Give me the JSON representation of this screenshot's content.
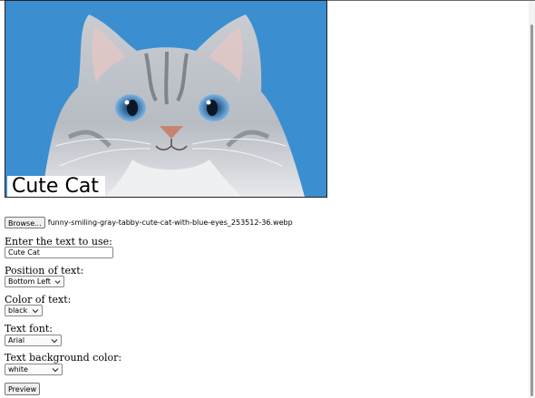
{
  "canvas": {
    "caption_text": "Cute Cat",
    "caption_color": "#000000",
    "caption_background": "#ffffff",
    "background_color": "#3b8fd0"
  },
  "file": {
    "browse_label": "Browse...",
    "file_name": "funny-smiling-gray-tabby-cute-cat-with-blue-eyes_253512-36.webp"
  },
  "form": {
    "text_label": "Enter the text to use:",
    "text_value": "Cute Cat",
    "position_label": "Position of text:",
    "position_value": "Bottom Left",
    "color_label": "Color of text:",
    "color_value": "black",
    "font_label": "Text font:",
    "font_value": "Arial",
    "bg_label": "Text background color:",
    "bg_value": "white",
    "preview_label": "Preview"
  },
  "icons": {
    "select_arrow": "chevron-down-icon"
  }
}
